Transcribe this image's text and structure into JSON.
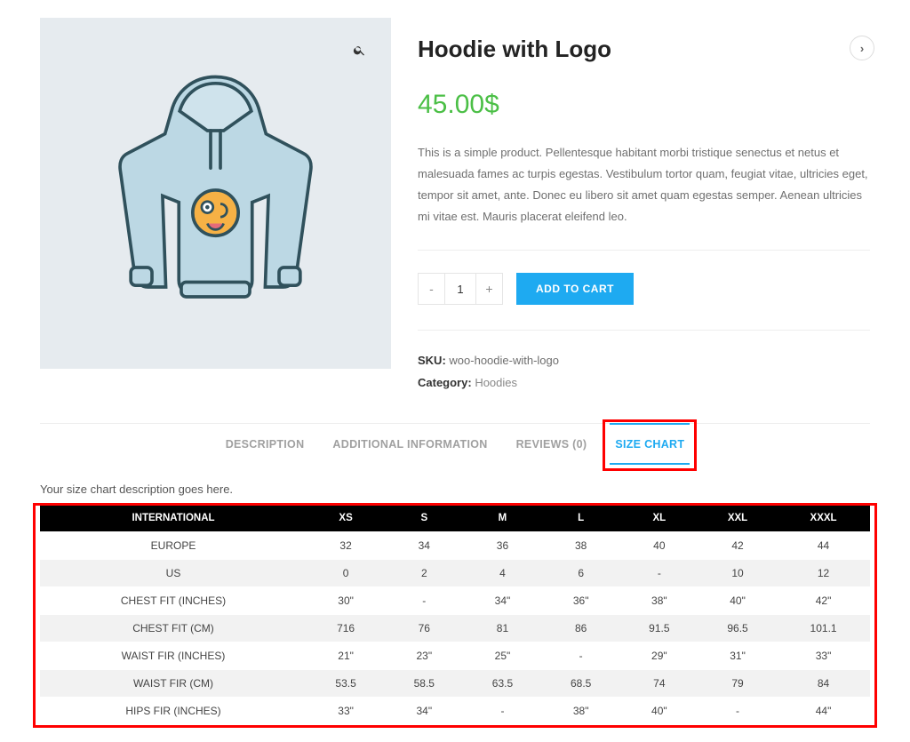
{
  "product": {
    "title": "Hoodie with Logo",
    "price": "45.00$",
    "short_description": "This is a simple product. Pellentesque habitant morbi tristique senectus et netus et malesuada fames ac turpis egestas. Vestibulum tortor quam, feugiat vitae, ultricies eget, tempor sit amet, ante. Donec eu libero sit amet quam egestas semper. Aenean ultricies mi vitae est. Mauris placerat eleifend leo.",
    "qty_value": "1",
    "qty_minus": "-",
    "qty_plus": "+",
    "add_to_cart_label": "ADD TO CART",
    "sku_label": "SKU:",
    "sku_value": "woo-hoodie-with-logo",
    "category_label": "Category:",
    "category_value": "Hoodies"
  },
  "tabs": {
    "description": "DESCRIPTION",
    "additional": "ADDITIONAL INFORMATION",
    "reviews": "REVIEWS (0)",
    "sizechart": "SIZE CHART"
  },
  "size_chart": {
    "intro": "Your size chart description goes here.",
    "headers": [
      "INTERNATIONAL",
      "XS",
      "S",
      "M",
      "L",
      "XL",
      "XXL",
      "XXXL"
    ],
    "rows": [
      [
        "EUROPE",
        "32",
        "34",
        "36",
        "38",
        "40",
        "42",
        "44"
      ],
      [
        "US",
        "0",
        "2",
        "4",
        "6",
        "-",
        "10",
        "12"
      ],
      [
        "CHEST FIT (INCHES)",
        "30\"",
        "-",
        "34\"",
        "36\"",
        "38\"",
        "40\"",
        "42\""
      ],
      [
        "CHEST FIT (CM)",
        "716",
        "76",
        "81",
        "86",
        "91.5",
        "96.5",
        "101.1"
      ],
      [
        "WAIST FIR (INCHES)",
        "21\"",
        "23\"",
        "25\"",
        "-",
        "29\"",
        "31\"",
        "33\""
      ],
      [
        "WAIST FIR (CM)",
        "53.5",
        "58.5",
        "63.5",
        "68.5",
        "74",
        "79",
        "84"
      ],
      [
        "HIPS FIR (INCHES)",
        "33\"",
        "34\"",
        "-",
        "38\"",
        "40\"",
        "-",
        "44\""
      ]
    ]
  },
  "chart_data": {
    "type": "table",
    "title": "Size Chart",
    "columns": [
      "INTERNATIONAL",
      "XS",
      "S",
      "M",
      "L",
      "XL",
      "XXL",
      "XXXL"
    ],
    "rows": [
      {
        "label": "EUROPE",
        "values": [
          32,
          34,
          36,
          38,
          40,
          42,
          44
        ]
      },
      {
        "label": "US",
        "values": [
          0,
          2,
          4,
          6,
          null,
          10,
          12
        ]
      },
      {
        "label": "CHEST FIT (INCHES)",
        "values": [
          30,
          null,
          34,
          36,
          38,
          40,
          42
        ],
        "unit": "in"
      },
      {
        "label": "CHEST FIT (CM)",
        "values": [
          716,
          76,
          81,
          86,
          91.5,
          96.5,
          101.1
        ],
        "unit": "cm"
      },
      {
        "label": "WAIST FIR (INCHES)",
        "values": [
          21,
          23,
          25,
          null,
          29,
          31,
          33
        ],
        "unit": "in"
      },
      {
        "label": "WAIST FIR (CM)",
        "values": [
          53.5,
          58.5,
          63.5,
          68.5,
          74,
          79,
          84
        ],
        "unit": "cm"
      },
      {
        "label": "HIPS FIR (INCHES)",
        "values": [
          33,
          34,
          null,
          38,
          40,
          null,
          44
        ],
        "unit": "in"
      }
    ]
  }
}
